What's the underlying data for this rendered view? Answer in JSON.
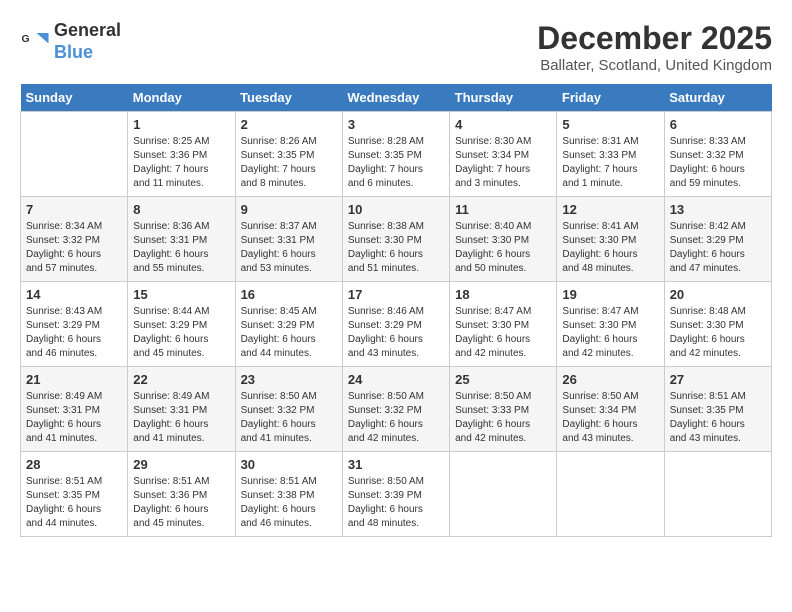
{
  "logo": {
    "line1": "General",
    "line2": "Blue"
  },
  "title": "December 2025",
  "subtitle": "Ballater, Scotland, United Kingdom",
  "headers": [
    "Sunday",
    "Monday",
    "Tuesday",
    "Wednesday",
    "Thursday",
    "Friday",
    "Saturday"
  ],
  "weeks": [
    [
      {
        "num": "",
        "info": ""
      },
      {
        "num": "1",
        "info": "Sunrise: 8:25 AM\nSunset: 3:36 PM\nDaylight: 7 hours\nand 11 minutes."
      },
      {
        "num": "2",
        "info": "Sunrise: 8:26 AM\nSunset: 3:35 PM\nDaylight: 7 hours\nand 8 minutes."
      },
      {
        "num": "3",
        "info": "Sunrise: 8:28 AM\nSunset: 3:35 PM\nDaylight: 7 hours\nand 6 minutes."
      },
      {
        "num": "4",
        "info": "Sunrise: 8:30 AM\nSunset: 3:34 PM\nDaylight: 7 hours\nand 3 minutes."
      },
      {
        "num": "5",
        "info": "Sunrise: 8:31 AM\nSunset: 3:33 PM\nDaylight: 7 hours\nand 1 minute."
      },
      {
        "num": "6",
        "info": "Sunrise: 8:33 AM\nSunset: 3:32 PM\nDaylight: 6 hours\nand 59 minutes."
      }
    ],
    [
      {
        "num": "7",
        "info": "Sunrise: 8:34 AM\nSunset: 3:32 PM\nDaylight: 6 hours\nand 57 minutes."
      },
      {
        "num": "8",
        "info": "Sunrise: 8:36 AM\nSunset: 3:31 PM\nDaylight: 6 hours\nand 55 minutes."
      },
      {
        "num": "9",
        "info": "Sunrise: 8:37 AM\nSunset: 3:31 PM\nDaylight: 6 hours\nand 53 minutes."
      },
      {
        "num": "10",
        "info": "Sunrise: 8:38 AM\nSunset: 3:30 PM\nDaylight: 6 hours\nand 51 minutes."
      },
      {
        "num": "11",
        "info": "Sunrise: 8:40 AM\nSunset: 3:30 PM\nDaylight: 6 hours\nand 50 minutes."
      },
      {
        "num": "12",
        "info": "Sunrise: 8:41 AM\nSunset: 3:30 PM\nDaylight: 6 hours\nand 48 minutes."
      },
      {
        "num": "13",
        "info": "Sunrise: 8:42 AM\nSunset: 3:29 PM\nDaylight: 6 hours\nand 47 minutes."
      }
    ],
    [
      {
        "num": "14",
        "info": "Sunrise: 8:43 AM\nSunset: 3:29 PM\nDaylight: 6 hours\nand 46 minutes."
      },
      {
        "num": "15",
        "info": "Sunrise: 8:44 AM\nSunset: 3:29 PM\nDaylight: 6 hours\nand 45 minutes."
      },
      {
        "num": "16",
        "info": "Sunrise: 8:45 AM\nSunset: 3:29 PM\nDaylight: 6 hours\nand 44 minutes."
      },
      {
        "num": "17",
        "info": "Sunrise: 8:46 AM\nSunset: 3:29 PM\nDaylight: 6 hours\nand 43 minutes."
      },
      {
        "num": "18",
        "info": "Sunrise: 8:47 AM\nSunset: 3:30 PM\nDaylight: 6 hours\nand 42 minutes."
      },
      {
        "num": "19",
        "info": "Sunrise: 8:47 AM\nSunset: 3:30 PM\nDaylight: 6 hours\nand 42 minutes."
      },
      {
        "num": "20",
        "info": "Sunrise: 8:48 AM\nSunset: 3:30 PM\nDaylight: 6 hours\nand 42 minutes."
      }
    ],
    [
      {
        "num": "21",
        "info": "Sunrise: 8:49 AM\nSunset: 3:31 PM\nDaylight: 6 hours\nand 41 minutes."
      },
      {
        "num": "22",
        "info": "Sunrise: 8:49 AM\nSunset: 3:31 PM\nDaylight: 6 hours\nand 41 minutes."
      },
      {
        "num": "23",
        "info": "Sunrise: 8:50 AM\nSunset: 3:32 PM\nDaylight: 6 hours\nand 41 minutes."
      },
      {
        "num": "24",
        "info": "Sunrise: 8:50 AM\nSunset: 3:32 PM\nDaylight: 6 hours\nand 42 minutes."
      },
      {
        "num": "25",
        "info": "Sunrise: 8:50 AM\nSunset: 3:33 PM\nDaylight: 6 hours\nand 42 minutes."
      },
      {
        "num": "26",
        "info": "Sunrise: 8:50 AM\nSunset: 3:34 PM\nDaylight: 6 hours\nand 43 minutes."
      },
      {
        "num": "27",
        "info": "Sunrise: 8:51 AM\nSunset: 3:35 PM\nDaylight: 6 hours\nand 43 minutes."
      }
    ],
    [
      {
        "num": "28",
        "info": "Sunrise: 8:51 AM\nSunset: 3:35 PM\nDaylight: 6 hours\nand 44 minutes."
      },
      {
        "num": "29",
        "info": "Sunrise: 8:51 AM\nSunset: 3:36 PM\nDaylight: 6 hours\nand 45 minutes."
      },
      {
        "num": "30",
        "info": "Sunrise: 8:51 AM\nSunset: 3:38 PM\nDaylight: 6 hours\nand 46 minutes."
      },
      {
        "num": "31",
        "info": "Sunrise: 8:50 AM\nSunset: 3:39 PM\nDaylight: 6 hours\nand 48 minutes."
      },
      {
        "num": "",
        "info": ""
      },
      {
        "num": "",
        "info": ""
      },
      {
        "num": "",
        "info": ""
      }
    ]
  ]
}
